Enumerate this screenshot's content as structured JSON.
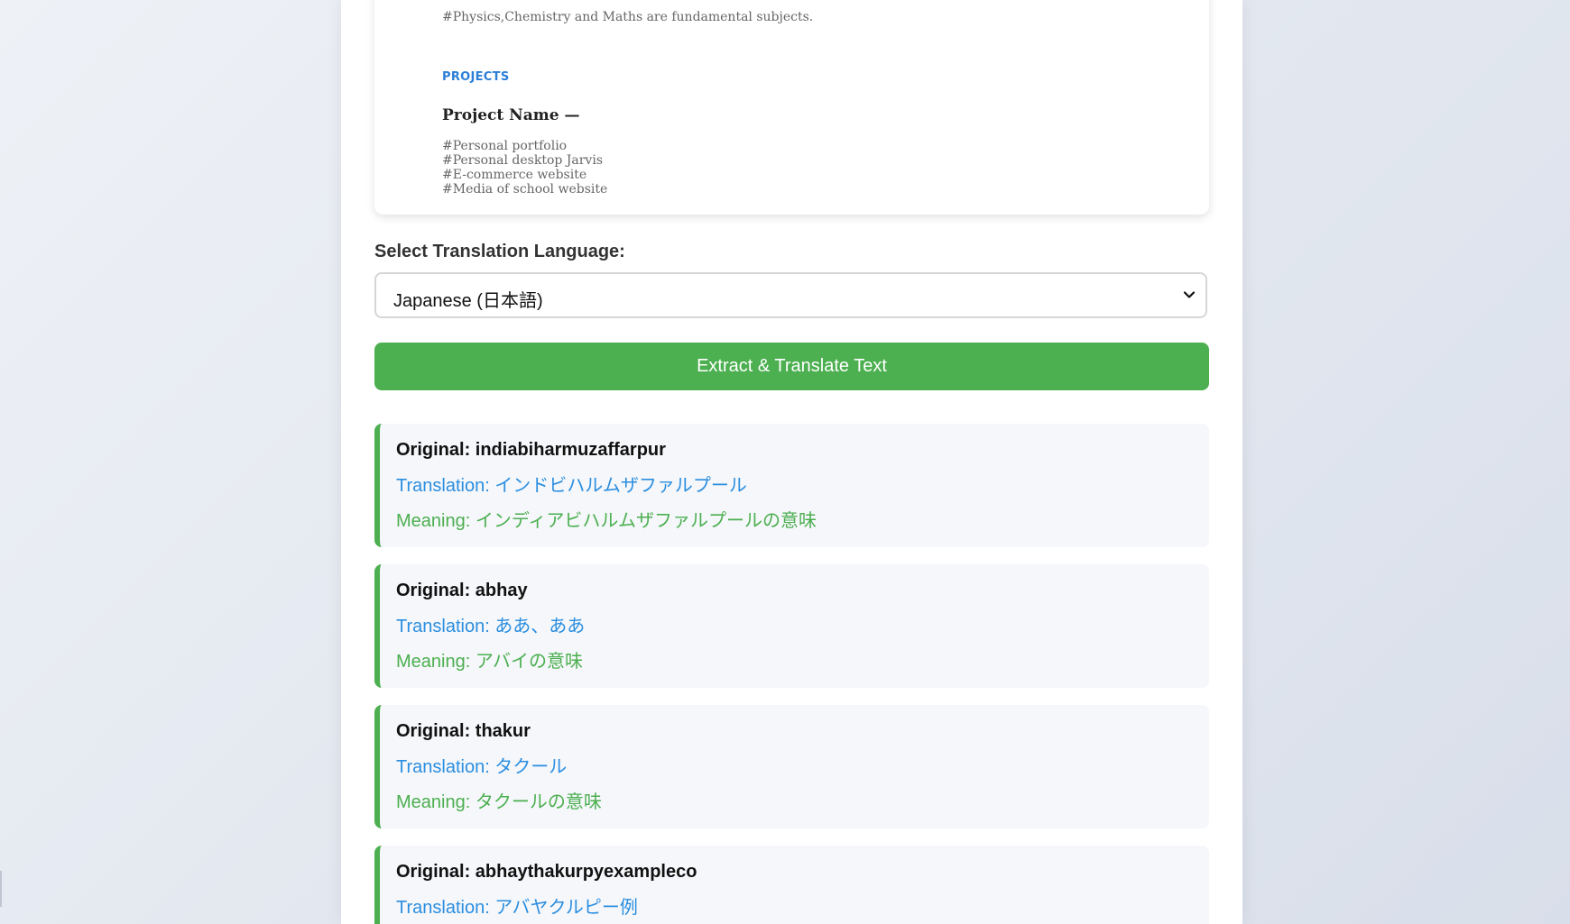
{
  "resume_preview": {
    "subjects_text": "#Physics,Chemistry and Maths are fundamental subjects.",
    "projects_heading": "PROJECTS",
    "project_name_label": "Project Name —",
    "projects": [
      "#Personal portfolio",
      "#Personal desktop Jarvis",
      "#E-commerce website",
      "#Media of school website"
    ]
  },
  "language_select": {
    "label": "Select Translation Language:",
    "selected": "Japanese (日本語)"
  },
  "extract_button": {
    "label": "Extract & Translate Text"
  },
  "results": [
    {
      "original": "Original: indiabiharmuzaffarpur",
      "translation": "Translation: インドビハルムザファルプール",
      "meaning": "Meaning: インディアビハルムザファルプールの意味"
    },
    {
      "original": "Original: abhay",
      "translation": "Translation: ああ、ああ",
      "meaning": "Meaning: アバイの意味"
    },
    {
      "original": "Original: thakur",
      "translation": "Translation: タクール",
      "meaning": "Meaning: タクールの意味"
    },
    {
      "original": "Original: abhaythakurpyexampleco",
      "translation": "Translation: アバヤクルピー例",
      "meaning": ""
    }
  ],
  "colors": {
    "accent_green": "#4caf50",
    "translation_blue": "#2b8ee0",
    "heading_blue": "#2b7fd6"
  }
}
